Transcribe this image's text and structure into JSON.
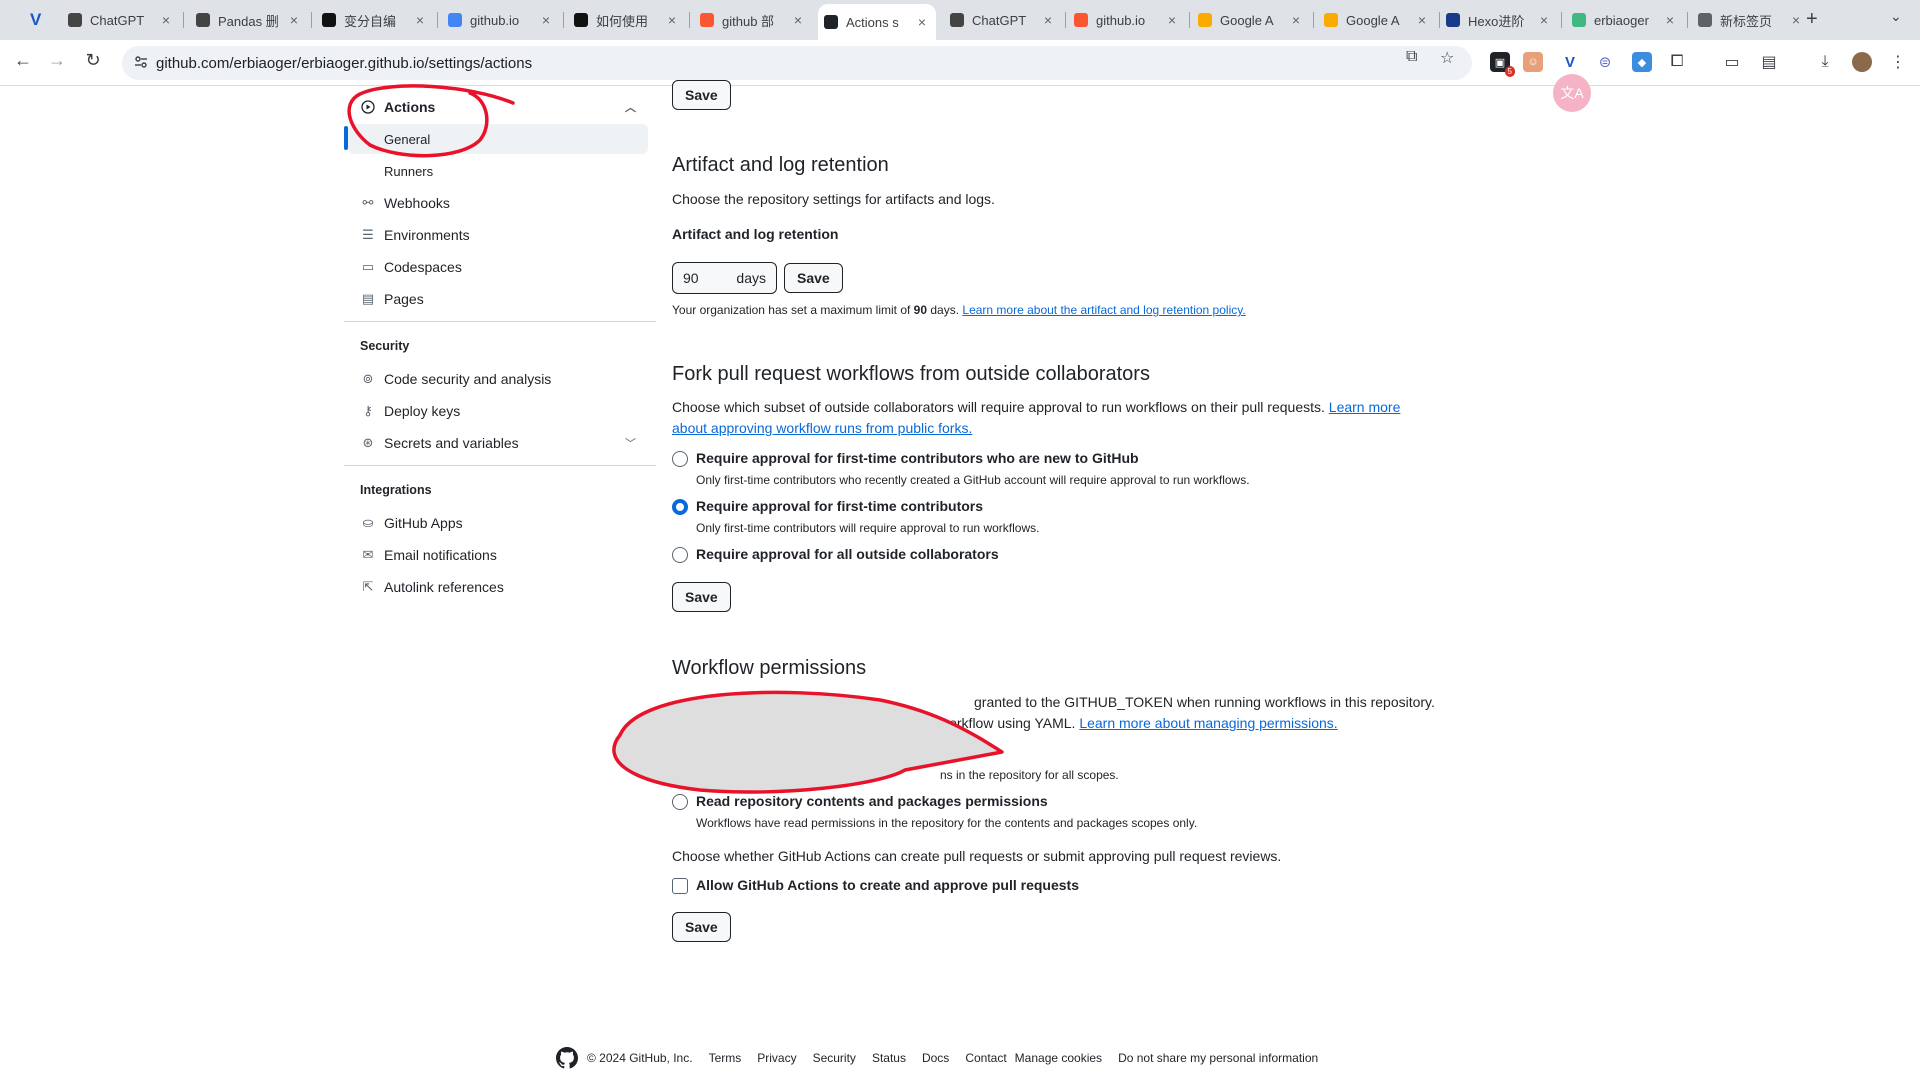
{
  "browser": {
    "tabs": [
      {
        "label": "ChatGPT",
        "fav": "openai-icon",
        "color": "#444"
      },
      {
        "label": "Pandas 删",
        "fav": "openai-icon",
        "color": "#444"
      },
      {
        "label": "变分自编",
        "fav": "notion-icon",
        "color": "#111"
      },
      {
        "label": "github.io",
        "fav": "google-icon",
        "color": "#4285f4"
      },
      {
        "label": "如何使用",
        "fav": "csdn-icon",
        "color": "#111"
      },
      {
        "label": "github 部",
        "fav": "csdn-red-icon",
        "color": "#fc5531"
      },
      {
        "label": "Actions s",
        "fav": "github-icon",
        "color": "#1f2328",
        "active": true
      },
      {
        "label": "ChatGPT",
        "fav": "openai-icon",
        "color": "#444"
      },
      {
        "label": "github.io",
        "fav": "csdn-red-icon",
        "color": "#fc5531"
      },
      {
        "label": "Google A",
        "fav": "analytics-icon",
        "color": "#f9ab00"
      },
      {
        "label": "Google A",
        "fav": "analytics-icon",
        "color": "#f9ab00"
      },
      {
        "label": "Hexo进阶",
        "fav": "sky-icon",
        "color": "#1a3a8a"
      },
      {
        "label": "erbiaoger",
        "fav": "vue-icon",
        "color": "#41b883"
      },
      {
        "label": "新标签页",
        "fav": "chrome-icon",
        "color": "#5f6368"
      }
    ],
    "url": "github.com/erbiaoger/erbiaoger.github.io/settings/actions",
    "ext_badge": "5"
  },
  "sidebar": {
    "actions": "Actions",
    "general": "General",
    "runners": "Runners",
    "webhooks": "Webhooks",
    "environments": "Environments",
    "codespaces": "Codespaces",
    "pages": "Pages",
    "security_head": "Security",
    "code_security": "Code security and analysis",
    "deploy_keys": "Deploy keys",
    "secrets": "Secrets and variables",
    "integrations_head": "Integrations",
    "github_apps": "GitHub Apps",
    "email_notifications": "Email notifications",
    "autolink": "Autolink references"
  },
  "main": {
    "save": "Save",
    "artifact": {
      "title": "Artifact and log retention",
      "desc": "Choose the repository settings for artifacts and logs.",
      "label": "Artifact and log retention",
      "days_value": "90",
      "days_unit": "days",
      "note_pre": "Your organization has set a maximum limit of ",
      "note_bold": "90",
      "note_post": " days. ",
      "note_link": "Learn more about the artifact and log retention policy."
    },
    "fork": {
      "title": "Fork pull request workflows from outside collaborators",
      "desc": "Choose which subset of outside collaborators will require approval to run workflows on their pull requests. ",
      "desc_link": "Learn more about approving workflow runs from public forks.",
      "options": [
        {
          "title": "Require approval for first-time contributors who are new to GitHub",
          "desc": "Only first-time contributors who recently created a GitHub account will require approval to run workflows.",
          "checked": false
        },
        {
          "title": "Require approval for first-time contributors",
          "desc": "Only first-time contributors will require approval to run workflows.",
          "checked": true
        },
        {
          "title": "Require approval for all outside collaborators",
          "desc": "",
          "checked": false
        }
      ]
    },
    "workflow": {
      "title": "Workflow permissions",
      "desc_a": "granted to the GITHUB_TOKEN when running workflows in this repository. You can",
      "desc_b": "workflow using YAML. ",
      "desc_link": "Learn more about managing permissions.",
      "obscured_desc": "ns in the repository for all scopes.",
      "read_title": "Read repository contents and packages permissions",
      "read_desc": "Workflows have read permissions in the repository for the contents and packages scopes only.",
      "pr_desc": "Choose whether GitHub Actions can create pull requests or submit approving pull request reviews.",
      "pr_checkbox": "Allow GitHub Actions to create and approve pull requests",
      "pr_checked": false
    },
    "avatar_text": "文A"
  },
  "footer": {
    "copyright": "© 2024 GitHub, Inc.",
    "links": [
      "Terms",
      "Privacy",
      "Security",
      "Status",
      "Docs",
      "Contact",
      "Manage cookies",
      "Do not share my personal information"
    ]
  },
  "colors": {
    "accent": "#0969da",
    "annotation": "#e8132b",
    "redaction": "#dedede"
  }
}
